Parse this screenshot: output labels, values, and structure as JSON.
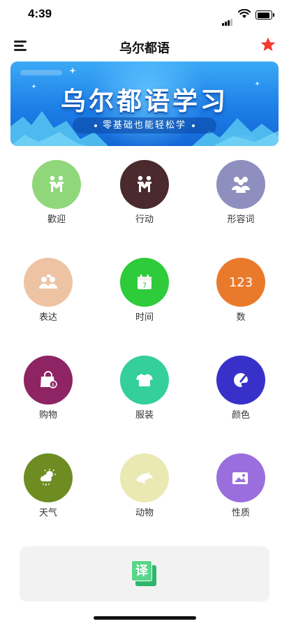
{
  "status_bar": {
    "time": "4:39"
  },
  "nav": {
    "title": "乌尔都语",
    "menu_icon": "hamburger-menu-icon",
    "favorite_icon": "star-icon",
    "star_color": "#f03a2e"
  },
  "banner": {
    "title": "乌尔都语学习",
    "subtitle": "零基础也能轻松学"
  },
  "categories": [
    {
      "label": "歡迎",
      "icon": "handshake-icon",
      "color": "#8fd77a"
    },
    {
      "label": "行动",
      "icon": "two-people-icon",
      "color": "#4a2a2c"
    },
    {
      "label": "形容词",
      "icon": "group-icon",
      "color": "#8f8fbf"
    },
    {
      "label": "表达",
      "icon": "chat-people-icon",
      "color": "#edc3a3"
    },
    {
      "label": "时间",
      "icon": "calendar-icon",
      "color": "#2ecb3b",
      "icon_text": "7"
    },
    {
      "label": "数",
      "icon": "numbers-icon",
      "color": "#ea7a2b",
      "icon_text": "123"
    },
    {
      "label": "购物",
      "icon": "shopping-bag-icon",
      "color": "#8e2463"
    },
    {
      "label": "服装",
      "icon": "tshirt-icon",
      "color": "#34cf9b"
    },
    {
      "label": "颜色",
      "icon": "palette-icon",
      "color": "#3831c9"
    },
    {
      "label": "天气",
      "icon": "weather-icon",
      "color": "#6d8c22"
    },
    {
      "label": "动物",
      "icon": "dolphin-icon",
      "color": "#ebe9b3"
    },
    {
      "label": "性质",
      "icon": "picture-icon",
      "color": "#9a6fdd"
    }
  ],
  "translate": {
    "icon": "translate-icon",
    "icon_text": "译"
  }
}
